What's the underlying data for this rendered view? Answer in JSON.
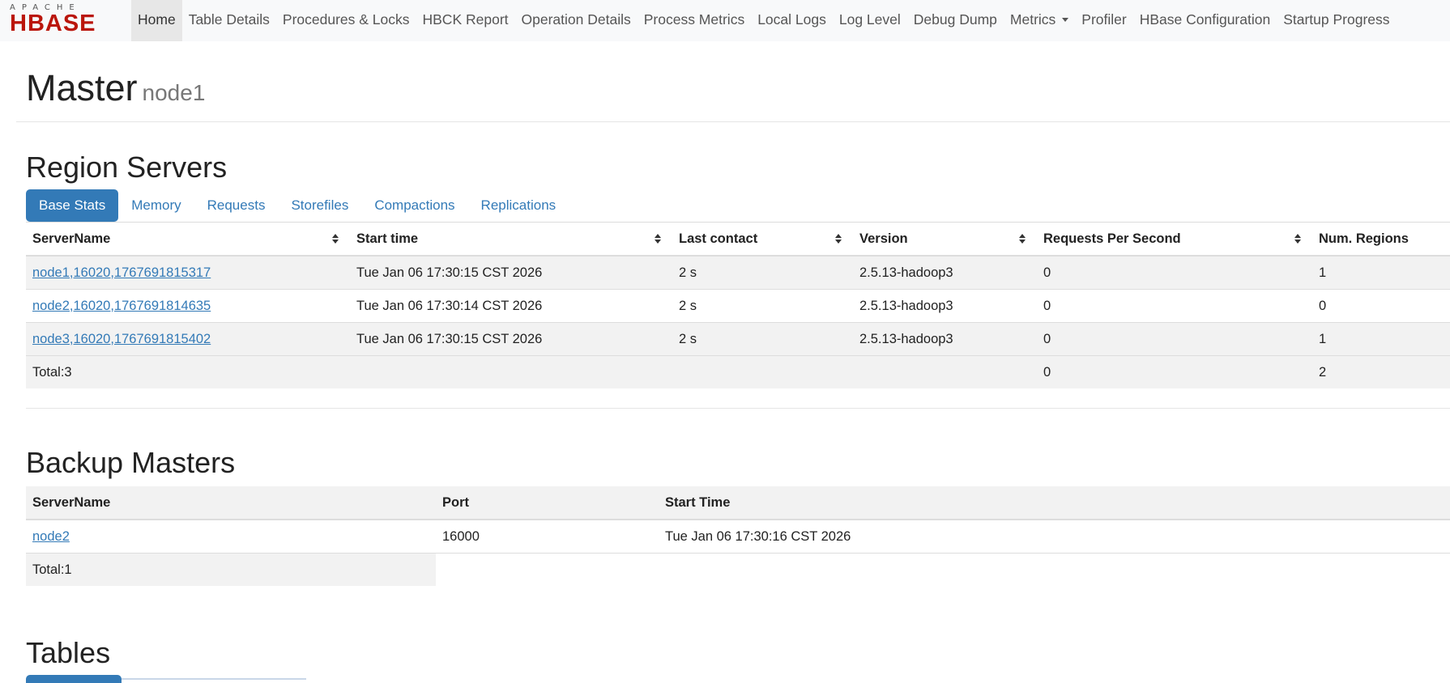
{
  "logo": {
    "apache": "APACHE",
    "hbase": "HBASE"
  },
  "nav": {
    "items": [
      {
        "label": "Home",
        "active": true
      },
      {
        "label": "Table Details"
      },
      {
        "label": "Procedures & Locks"
      },
      {
        "label": "HBCK Report"
      },
      {
        "label": "Operation Details"
      },
      {
        "label": "Process Metrics"
      },
      {
        "label": "Local Logs"
      },
      {
        "label": "Log Level"
      },
      {
        "label": "Debug Dump"
      },
      {
        "label": "Metrics",
        "dropdown": true
      },
      {
        "label": "Profiler"
      },
      {
        "label": "HBase Configuration"
      },
      {
        "label": "Startup Progress"
      }
    ]
  },
  "header": {
    "title": "Master",
    "subtitle": "node1"
  },
  "region_servers": {
    "title": "Region Servers",
    "tabs": [
      "Base Stats",
      "Memory",
      "Requests",
      "Storefiles",
      "Compactions",
      "Replications"
    ],
    "active_tab": "Base Stats",
    "columns": [
      "ServerName",
      "Start time",
      "Last contact",
      "Version",
      "Requests Per Second",
      "Num. Regions"
    ],
    "rows": [
      {
        "server": "node1,16020,1767691815317",
        "start": "Tue Jan 06 17:30:15 CST 2026",
        "contact": "2 s",
        "version": "2.5.13-hadoop3",
        "rps": "0",
        "regions": "1"
      },
      {
        "server": "node2,16020,1767691814635",
        "start": "Tue Jan 06 17:30:14 CST 2026",
        "contact": "2 s",
        "version": "2.5.13-hadoop3",
        "rps": "0",
        "regions": "0"
      },
      {
        "server": "node3,16020,1767691815402",
        "start": "Tue Jan 06 17:30:15 CST 2026",
        "contact": "2 s",
        "version": "2.5.13-hadoop3",
        "rps": "0",
        "regions": "1"
      }
    ],
    "total": {
      "label": "Total:3",
      "rps": "0",
      "regions": "2"
    }
  },
  "backup_masters": {
    "title": "Backup Masters",
    "columns": [
      "ServerName",
      "Port",
      "Start Time"
    ],
    "rows": [
      {
        "server": "node2",
        "port": "16000",
        "start": "Tue Jan 06 17:30:16 CST 2026"
      }
    ],
    "total": "Total:1"
  },
  "tables": {
    "title": "Tables"
  },
  "colors": {
    "accent": "#337ab7",
    "brand": "#ba160c",
    "stripe": "#f2f2f2"
  }
}
